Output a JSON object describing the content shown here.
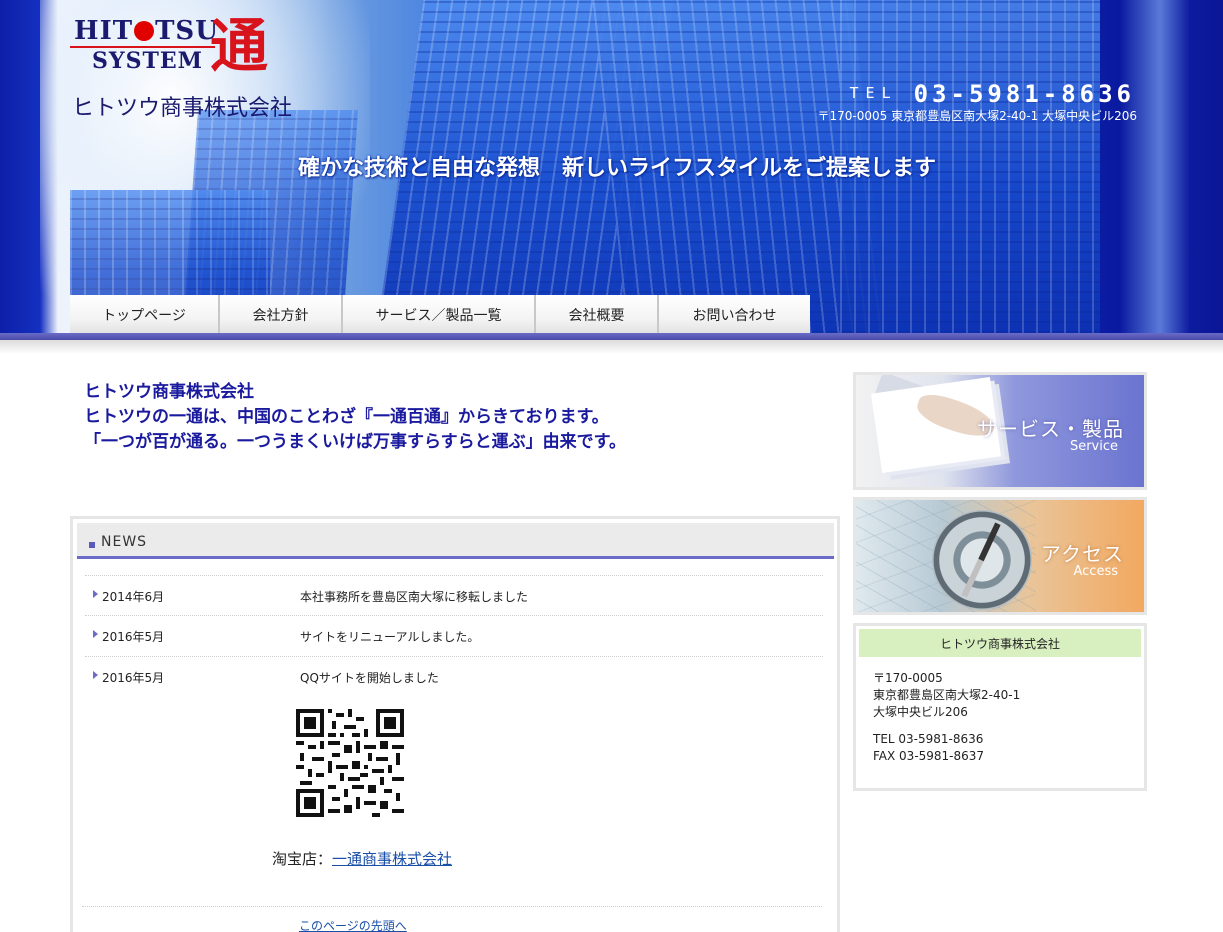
{
  "header": {
    "logo_text_line1_a": "HIT",
    "logo_text_line1_b": "TSU",
    "logo_text_line2": "SYSTEM",
    "logo_kanji": "通",
    "company_name": "ヒトツウ商事株式会社",
    "tel_label": "TEL",
    "tel_number": "03-5981-8636",
    "address": "〒170-0005 東京都豊島区南大塚2-40-1 大塚中央ビル206",
    "tagline": "確かな技術と自由な発想　新しいライフスタイルをご提案します"
  },
  "nav": {
    "items": [
      {
        "label": "トップページ"
      },
      {
        "label": "会社方針"
      },
      {
        "label": "サービス／製品一覧"
      },
      {
        "label": "会社概要"
      },
      {
        "label": "お問い合わせ"
      }
    ]
  },
  "intro": {
    "line1": "ヒトツウ商事株式会社",
    "line2": "ヒトツウの一通は、中国のことわざ『一通百通』からきております。",
    "line3": "「一つが百が通る。一つうまくいけば万事すらすらと運ぶ」由来です。"
  },
  "news": {
    "title": "NEWS",
    "items": [
      {
        "date": "2014年6月",
        "text": "本社事務所を豊島区南大塚に移転しました"
      },
      {
        "date": "2016年5月",
        "text": "サイトをリニューアルしました。"
      },
      {
        "date": "2016年5月",
        "text": "QQサイトを開始しました"
      }
    ],
    "taobao_label": "淘宝店：",
    "taobao_link": "一通商事株式会社",
    "page_top_link": "このページの先頭へ"
  },
  "sidebar": {
    "service_banner": {
      "jp": "サービス・製品",
      "en": "Service"
    },
    "access_banner": {
      "jp": "アクセス",
      "en": "Access"
    },
    "info": {
      "title": "ヒトツウ商事株式会社",
      "postal": "〒170-0005",
      "address1": "東京都豊島区南大塚2-40-1",
      "address2": "大塚中央ビル206",
      "tel": "TEL 03-5981-8636",
      "fax": "FAX 03-5981-8637"
    }
  },
  "colors": {
    "header_blue": "#0c2cb4",
    "nav_accent": "#6b6bc8",
    "intro_text": "#1a1a9e",
    "logo_red": "#d8131c",
    "info_title_bg": "#d8efc0"
  },
  "icons": [
    "news-square-icon",
    "news-arrow-icon",
    "qr-code-icon",
    "logo-dot-icon"
  ]
}
